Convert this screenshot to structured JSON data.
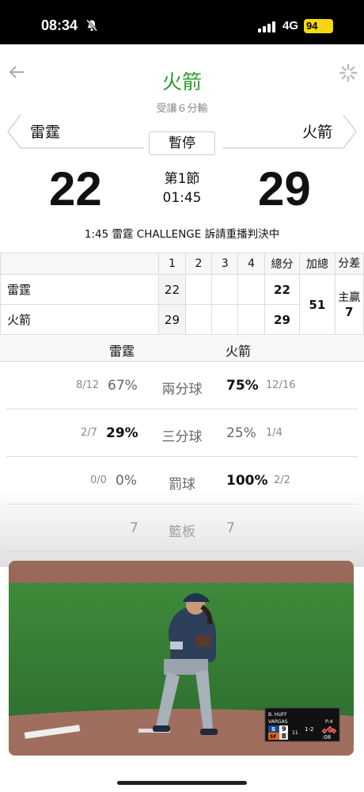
{
  "status_bar": {
    "time": "08:34",
    "network": "4G",
    "battery": "94"
  },
  "header": {
    "team_title": "火箭",
    "spread": "受讓６分輸"
  },
  "matchup": {
    "away_name": "雷霆",
    "home_name": "火箭",
    "status": "暫停",
    "away_score": "22",
    "home_score": "29",
    "period": "第1節",
    "clock": "01:45",
    "event_text": "1:45 雷霆 CHALLENGE 訴請重播判決中"
  },
  "boxscore": {
    "headers": [
      "1",
      "2",
      "3",
      "4",
      "總分",
      "加總",
      "分差"
    ],
    "rows": [
      {
        "team": "雷霆",
        "q": [
          "22",
          "",
          "",
          ""
        ],
        "total": "22"
      },
      {
        "team": "火箭",
        "q": [
          "29",
          "",
          "",
          ""
        ],
        "total": "29"
      }
    ],
    "aggregate": "51",
    "diff_label": "主贏",
    "diff_value": "7"
  },
  "stats": {
    "away_team": "雷霆",
    "home_team": "火箭",
    "rows": [
      {
        "label": "兩分球",
        "away_frac": "8/12",
        "away_pct": "67%",
        "home_pct": "75%",
        "home_frac": "12/16"
      },
      {
        "label": "三分球",
        "away_frac": "2/7",
        "away_pct": "29%",
        "home_pct": "25%",
        "home_frac": "1/4"
      },
      {
        "label": "罰球",
        "away_frac": "0/0",
        "away_pct": "0%",
        "home_pct": "100%",
        "home_frac": "2/2"
      },
      {
        "label": "籃板",
        "away_frac": "",
        "away_pct": "7",
        "home_pct": "7",
        "home_frac": ""
      }
    ]
  },
  "video": {
    "pitcher": "B. HUFF",
    "batter": "VARGAS",
    "pitch_count": "P:4",
    "team1": "S",
    "team1_score": "9",
    "team2": "SF",
    "team2_score": "8",
    "inning": "11",
    "count": "1-2",
    "clock": ":08"
  },
  "colors": {
    "accent_green": "#2a9d2a",
    "battery_yellow": "#f5d90a"
  }
}
